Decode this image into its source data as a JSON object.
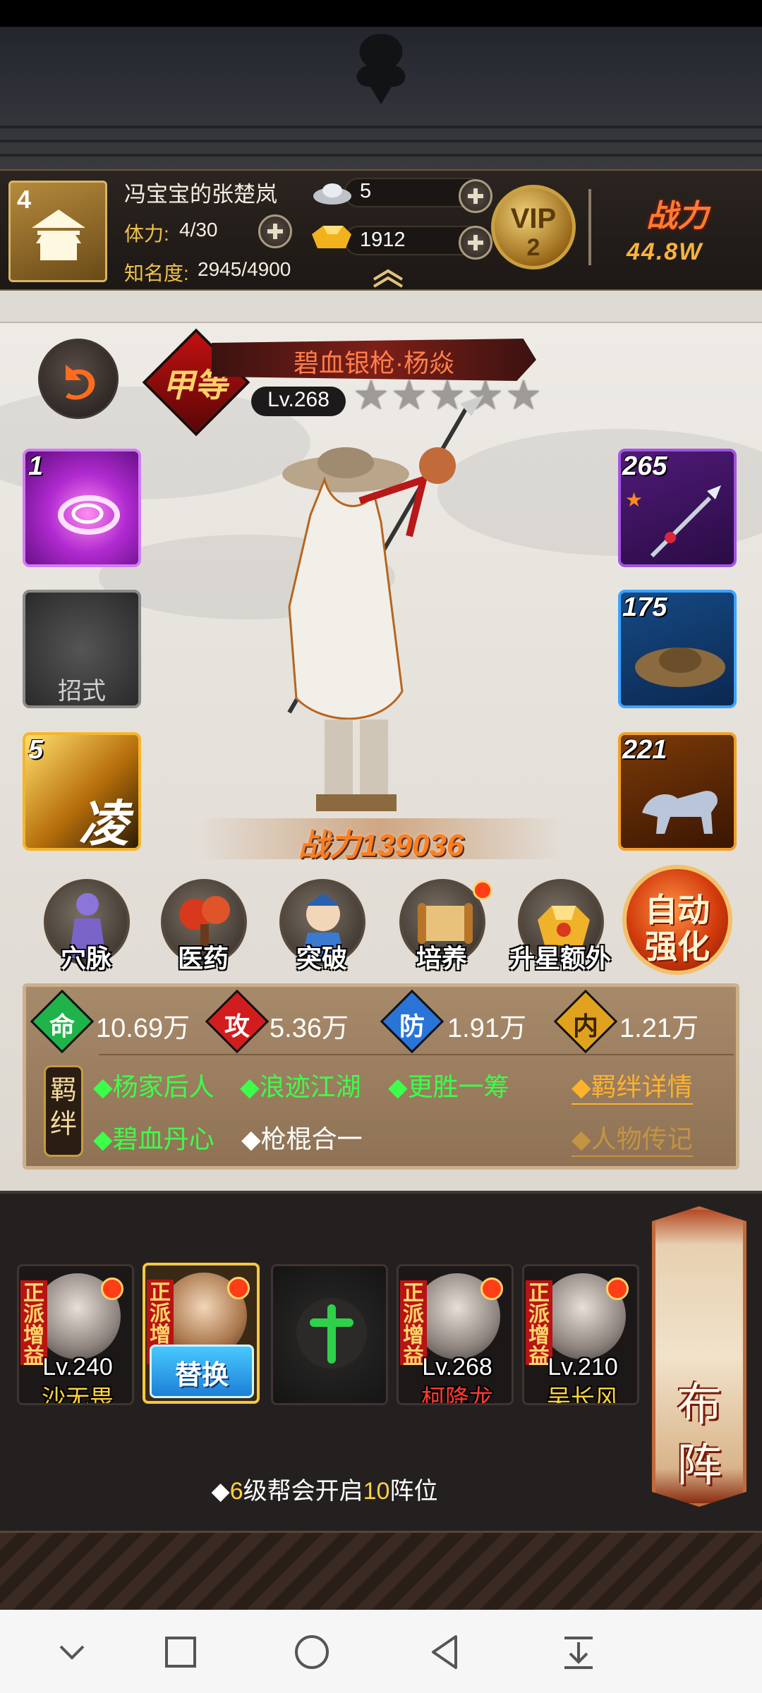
{
  "player": {
    "rank": "4",
    "name": "冯宝宝的张楚岚",
    "stamina_label": "体力:",
    "stamina_value": "4/30",
    "fame_label": "知名度:",
    "fame_value": "2945/4900"
  },
  "currency": {
    "silver": "5",
    "gold": "1912"
  },
  "vip": {
    "label": "VIP",
    "level": "2"
  },
  "team_power": {
    "label": "战力",
    "value": "44.8W"
  },
  "hero": {
    "grade": "甲等",
    "name": "碧血银枪·杨焱",
    "level": "Lv.268",
    "stars": 5,
    "power_label": "战力",
    "power_value": "139036"
  },
  "slots": {
    "skill1_num": "1",
    "empty_label": "招式",
    "skill3_num": "5",
    "skill3_glyph": "凌",
    "weapon_num": "265",
    "hat_num": "175",
    "mount_num": "221"
  },
  "functions": [
    {
      "label": "穴脉",
      "icon": "meridian-icon",
      "badge": false
    },
    {
      "label": "医药",
      "icon": "medicine-icon",
      "badge": false
    },
    {
      "label": "突破",
      "icon": "breakthrough-icon",
      "badge": false
    },
    {
      "label": "培养",
      "icon": "scroll-icon",
      "badge": true
    },
    {
      "label": "升星额外",
      "icon": "star-up-icon",
      "badge": false
    }
  ],
  "auto_strengthen": {
    "line1": "自动",
    "line2": "强化"
  },
  "stats": [
    {
      "char": "命",
      "value": "10.69万",
      "color": "#1fb34a"
    },
    {
      "char": "攻",
      "value": "5.36万",
      "color": "#d11d1d"
    },
    {
      "char": "防",
      "value": "1.91万",
      "color": "#2a74d8"
    },
    {
      "char": "内",
      "value": "1.21万",
      "color": "#e0a21e"
    }
  ],
  "bonds": {
    "tag": "羁绊",
    "row1": [
      "◆杨家后人",
      "◆浪迹江湖",
      "◆更胜一筹"
    ],
    "row2_green": "◆碧血丹心",
    "row2_white": "◆枪棍合一",
    "detail_link": "◆羁绊详情",
    "bio_link": "◆人物传记"
  },
  "formation": {
    "members": [
      {
        "tag": "正派增益",
        "level": "Lv.240",
        "name": "沙无畏",
        "name_color": "#ffd23c"
      },
      {
        "tag": "正派增益",
        "replace": "替换"
      },
      {
        "empty": true
      },
      {
        "tag": "正派增益",
        "level": "Lv.268",
        "name": "柯降龙",
        "name_color": "#ff3b30"
      },
      {
        "tag": "正派增益",
        "level": "Lv.210",
        "name": "吴长风",
        "name_color": "#ffd23c"
      }
    ],
    "button_line1": "布",
    "button_line2": "阵",
    "hint_prefix": "◆",
    "hint_level": "6",
    "hint_mid": "级帮会开启",
    "hint_slots": "10",
    "hint_suffix": "阵位"
  },
  "nav": [
    "chevron-down-icon",
    "square-icon",
    "circle-icon",
    "back-triangle-icon",
    "download-icon"
  ]
}
